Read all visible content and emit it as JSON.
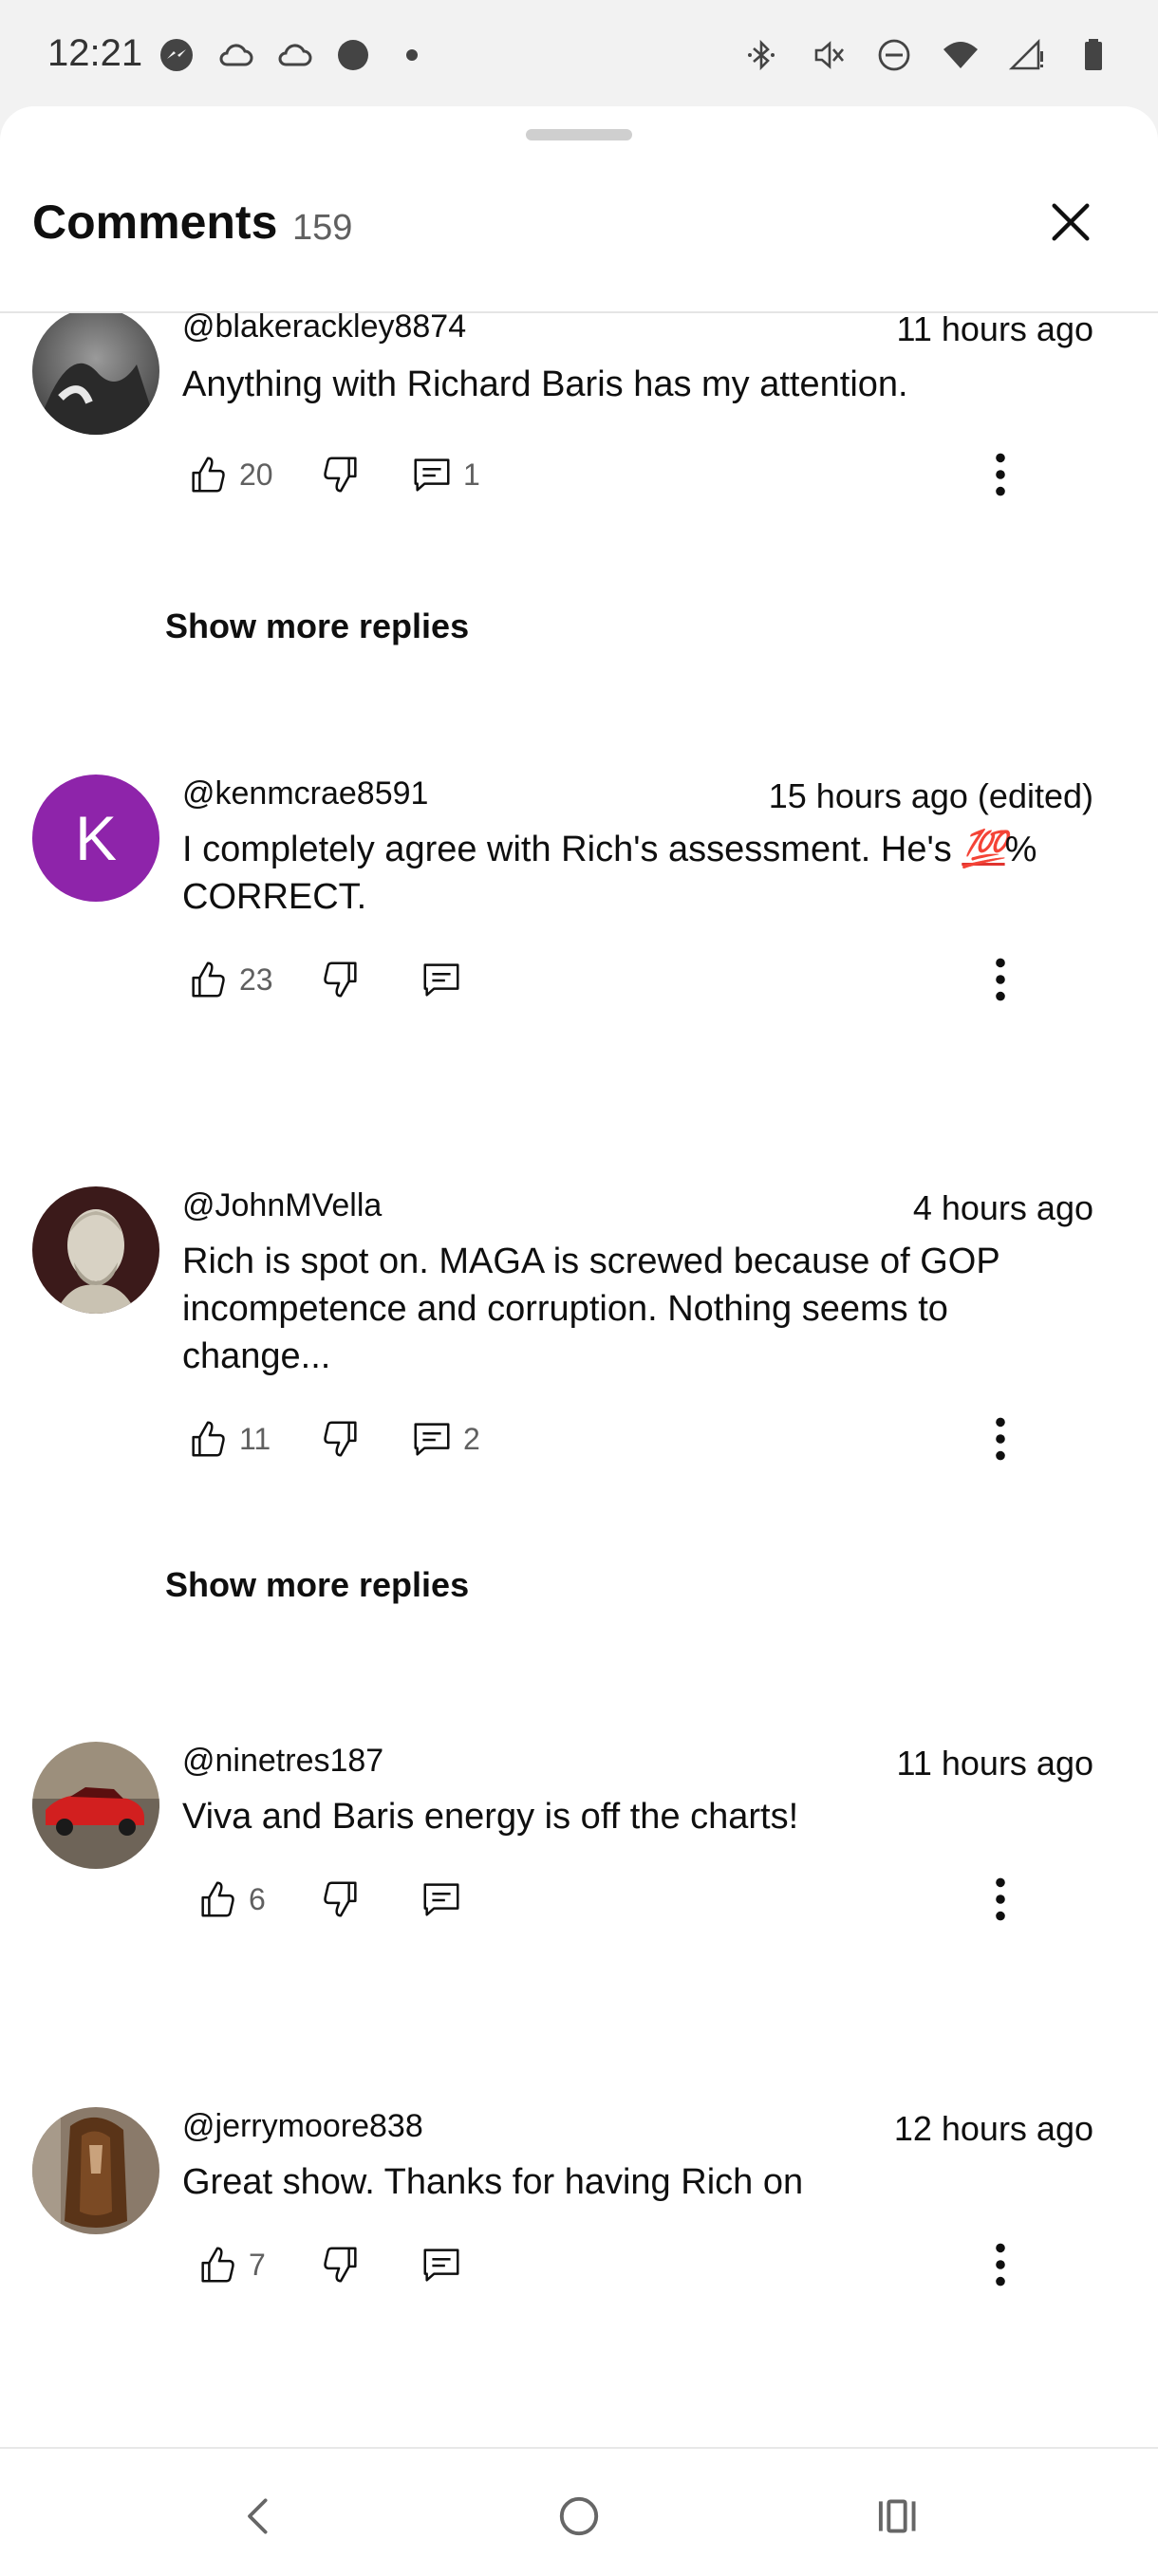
{
  "status_bar": {
    "time": "12:21",
    "left_icons": [
      "messenger-icon",
      "cloud-icon",
      "cloud-icon",
      "dot-filled-icon",
      "small-dot-icon"
    ],
    "right_icons": [
      "bluetooth-icon",
      "vibrate-mute-icon",
      "dnd-icon",
      "wifi-icon",
      "signal-icon",
      "battery-icon"
    ]
  },
  "header": {
    "title": "Comments",
    "count": "159"
  },
  "comments": [
    {
      "author": "@blakerackley8874",
      "time": "11 hours ago",
      "text": "Anything with Richard Baris has my attention.",
      "likes": "20",
      "replies": "1",
      "show_more": "Show more replies"
    },
    {
      "author": "@kenmcrae8591",
      "time": "15 hours ago (edited)",
      "text_before": "I completely agree with Rich's assessment. He's ",
      "emoji": "💯",
      "text_after": "% CORRECT.",
      "avatar_letter": "K",
      "likes": "23",
      "replies": ""
    },
    {
      "author": "@JohnMVella",
      "time": "4 hours ago",
      "text": "Rich is spot on. MAGA is screwed because of GOP incompetence and corruption. Nothing seems to change...",
      "likes": "11",
      "replies": "2",
      "show_more": "Show more replies"
    },
    {
      "author": "@ninetres187",
      "time": "11 hours ago",
      "text": "Viva and Baris energy is off the charts!",
      "likes": "6",
      "replies": ""
    },
    {
      "author": "@jerrymoore838",
      "time": "12 hours ago",
      "text": "Great show. Thanks for having Rich on",
      "likes": "7",
      "replies": ""
    }
  ],
  "colors": {
    "avatar_k": "#8e24aa",
    "secondary_text": "#606060",
    "sheet_bg": "#ffffff"
  },
  "nav": [
    "back-icon",
    "home-icon",
    "recents-icon"
  ]
}
